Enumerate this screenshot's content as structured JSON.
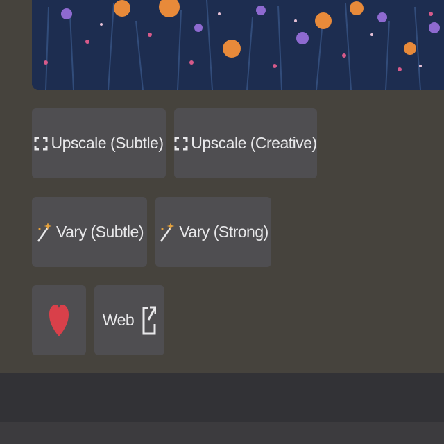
{
  "colors": {
    "background": "#46433d",
    "button_bg": "#4f4e51",
    "button_text": "#e8e8ea",
    "heart": "#d9404a",
    "wand": "#e6a23c"
  },
  "buttons": {
    "upscale_subtle": {
      "label": "Upscale (Subtle)",
      "icon": "upscale-icon"
    },
    "upscale_creative": {
      "label": "Upscale (Creative)",
      "icon": "upscale-icon"
    },
    "vary_subtle": {
      "label": "Vary (Subtle)",
      "icon": "magic-wand-icon"
    },
    "vary_strong": {
      "label": "Vary (Strong)",
      "icon": "magic-wand-icon"
    },
    "favorite": {
      "icon": "heart-icon"
    },
    "web": {
      "label": "Web",
      "icon": "external-link-icon"
    }
  }
}
